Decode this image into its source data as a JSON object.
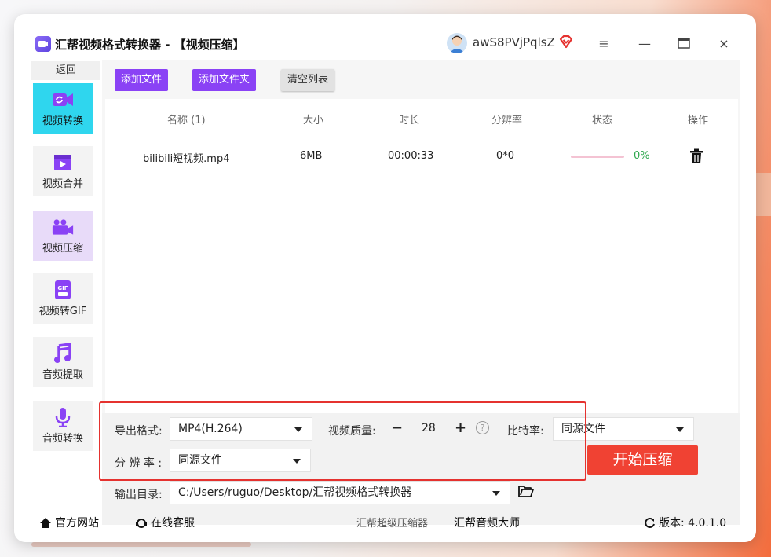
{
  "window": {
    "title": "汇帮视频格式转换器 - 【视频压缩】",
    "username": "awS8PVjPqlsZ",
    "controls": [
      "menu-icon",
      "minimize-icon",
      "maximize-icon",
      "close-icon"
    ],
    "menu_glyph": "≡",
    "minimize_glyph": "—",
    "maximize_glyph": "▭",
    "close_glyph": "×"
  },
  "sidebar": {
    "back_label": "返回",
    "items": [
      {
        "label": "视频转换",
        "icon": "video-convert-icon",
        "state": "active"
      },
      {
        "label": "视频合并",
        "icon": "video-merge-icon",
        "state": "normal"
      },
      {
        "label": "视频压缩",
        "icon": "video-compress-icon",
        "state": "selected"
      },
      {
        "label": "视频转GIF",
        "icon": "gif-icon",
        "state": "normal"
      },
      {
        "label": "音频提取",
        "icon": "music-note-icon",
        "state": "normal"
      },
      {
        "label": "音频转换",
        "icon": "microphone-icon",
        "state": "normal"
      }
    ]
  },
  "toolbar": {
    "add_file": "添加文件",
    "add_folder": "添加文件夹",
    "clear_list": "清空列表"
  },
  "table": {
    "headers": [
      "名称 (1)",
      "大小",
      "时长",
      "分辨率",
      "状态",
      "操作"
    ],
    "rows": [
      {
        "name": "bilibili短视频.mp4",
        "size": "6MB",
        "duration": "00:00:33",
        "resolution": "0*0",
        "progress_pct": "0%",
        "progress": 0.0
      }
    ]
  },
  "settings": {
    "format_label": "导出格式:",
    "format_value": "MP4(H.264)",
    "quality_label": "视频质量:",
    "quality_minus": "−",
    "quality_value": "28",
    "quality_plus": "+",
    "help": "?",
    "bitrate_label": "比特率:",
    "bitrate_value": "同源文件",
    "resolution_label": "分 辨 率 :",
    "resolution_value": "同源文件",
    "output_label": "输出目录:",
    "output_value": "C:/Users/ruguo/Desktop/汇帮视频格式转换器",
    "start_button": "开始压缩"
  },
  "footer": {
    "website": "官方网站",
    "support": "在线客服",
    "link1": "汇帮超级压缩器",
    "link2": "汇帮音频大师",
    "version": "版本: 4.0.1.0"
  },
  "colors": {
    "accent_purple": "#8a42f5",
    "active_cyan": "#2fd6ee",
    "start_red": "#f04233",
    "highlight_red": "#e5322f",
    "progress_green": "#2fa84f"
  }
}
